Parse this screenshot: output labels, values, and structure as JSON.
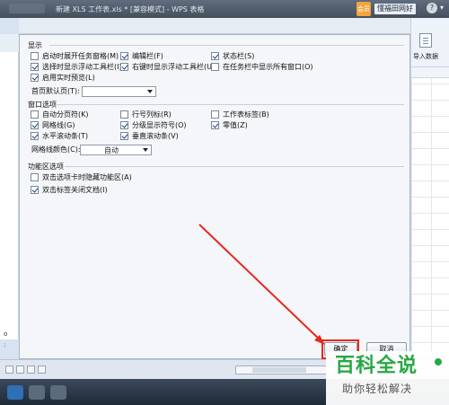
{
  "window": {
    "title": "新建 XLS 工作表.xls * [兼容模式] - WPS 表格",
    "user_icon_text": "会员",
    "user_label": "懂福田网好",
    "help_label": "?",
    "chevron": "▾"
  },
  "right_pane": {
    "import_label": "导入数据"
  },
  "left_strip": {
    "text1": "o",
    "text2": ":"
  },
  "dialog": {
    "display": {
      "heading": "显示",
      "options": [
        {
          "label": "启动时展开任务窗格(M)",
          "checked": false
        },
        {
          "label": "编辑栏(F)",
          "checked": true
        },
        {
          "label": "状态栏(S)",
          "checked": true
        },
        {
          "label": "选择时显示浮动工具栏(I)",
          "checked": true
        },
        {
          "label": "右键时显示浮动工具栏(U)",
          "checked": true
        },
        {
          "label": "在任务栏中显示所有窗口(O)",
          "checked": false
        },
        {
          "label": "启用实时预览(L)",
          "checked": true
        }
      ],
      "homepage_label": "首页默认页(T):",
      "homepage_value": ""
    },
    "window_options": {
      "heading": "窗口选项",
      "options": [
        {
          "label": "自动分页符(K)",
          "checked": false
        },
        {
          "label": "行号列标(R)",
          "checked": false
        },
        {
          "label": "工作表标签(B)",
          "checked": false
        },
        {
          "label": "网格线(G)",
          "checked": true
        },
        {
          "label": "分级显示符号(O)",
          "checked": true
        },
        {
          "label": "零值(Z)",
          "checked": true
        },
        {
          "label": "水平滚动条(T)",
          "checked": true
        },
        {
          "label": "垂直滚动条(V)",
          "checked": true
        }
      ],
      "gridline_color_label": "网格线颜色(C):",
      "gridline_color_value": "自动"
    },
    "ribbon_options": {
      "heading": "功能区选项",
      "options": [
        {
          "label": "双击选项卡时隐藏功能区(A)",
          "checked": false
        },
        {
          "label": "双击标签关闭文档(I)",
          "checked": true
        }
      ]
    },
    "ok_label": "确定",
    "cancel_label": "取消"
  },
  "watermark": {
    "title": "百科全说",
    "subtitle": "助你轻松解决"
  },
  "colors": {
    "accent_red": "#e5281e",
    "watermark_green": "#27a844"
  }
}
